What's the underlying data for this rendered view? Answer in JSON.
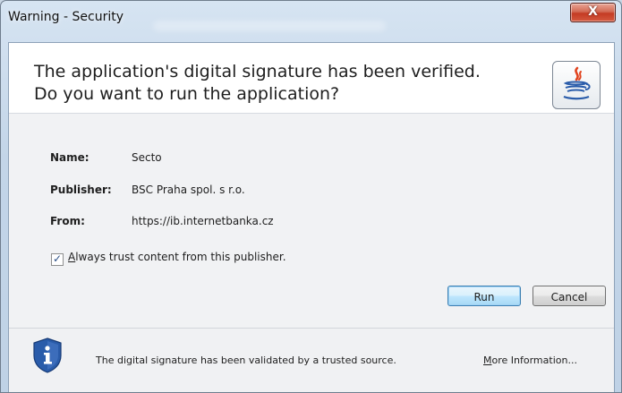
{
  "window": {
    "title": "Warning - Security",
    "close_symbol": "X"
  },
  "header": {
    "headline_line1": "The application's digital signature has been verified.",
    "headline_line2": "Do you want to run the application?",
    "icon": "java-icon"
  },
  "details": {
    "name_label": "Name:",
    "name_value": "Secto",
    "publisher_label": "Publisher:",
    "publisher_value": "BSC Praha spol. s r.o.",
    "from_label": "From:",
    "from_value": "https://ib.internetbanka.cz"
  },
  "trust_checkbox": {
    "checked": true,
    "label_accel": "A",
    "label_rest": "lways trust content from this publisher."
  },
  "buttons": {
    "run_label": "Run",
    "cancel_label": "Cancel"
  },
  "footer": {
    "icon": "info-shield-icon",
    "message": "The digital signature has been validated by a trusted source.",
    "more_accel": "M",
    "more_rest": "ore Information..."
  },
  "colors": {
    "accent_blue": "#3c7fb1",
    "close_red": "#c43b24",
    "shield_blue": "#2a5caa"
  }
}
